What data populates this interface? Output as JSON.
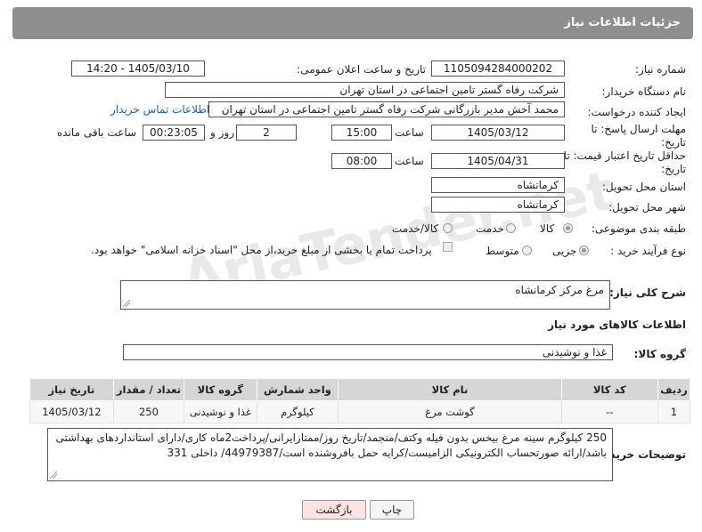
{
  "header": {
    "title": "جزئیات اطلاعات نیاز"
  },
  "form": {
    "need_number_label": "شماره نیاز:",
    "need_number": "1105094284000202",
    "announce_label": "تاریخ و ساعت اعلان عمومی:",
    "announce_value": "1405/03/10 - 14:20",
    "buyer_label": "نام دستگاه خریدار:",
    "buyer_value": "شرکت رفاه گستر تامین اجتماعی در استان تهران",
    "creator_label": "ایجاد کننده درخواست:",
    "creator_value": "محمد آخش مدیر بازرگانی شرکت رفاه گستر تامین اجتماعی در استان تهران",
    "contact_link": "اطلاعات تماس خریدار",
    "deadline_label": "مهلت ارسال پاسخ: تا تاریخ:",
    "deadline_date": "1405/03/12",
    "time_label": "ساعت",
    "deadline_time": "15:00",
    "days_value": "2",
    "days_label": "روز و",
    "remaining_value": "00:23:05",
    "remaining_label": "ساعت باقی مانده",
    "validity_label": "حداقل تاریخ اعتبار قیمت: تا تاریخ:",
    "validity_date": "1405/04/31",
    "validity_time": "08:00",
    "province_label": "استان محل تحویل:",
    "province_value": "کرمانشاه",
    "city_label": "شهر محل تحویل:",
    "city_value": "کرمانشاه",
    "category_label": "طبقه بندی موضوعی:",
    "category_options": [
      "کالا",
      "خدمت",
      "کالا/خدمت"
    ],
    "process_label": "نوع فرآیند خرید :",
    "process_options": [
      "جزیی",
      "متوسط"
    ],
    "payment_note": "پرداخت تمام یا بخشی از مبلغ خرید،از محل \"اسناد خزانه اسلامی\" خواهد بود."
  },
  "description": {
    "label": "شرح کلی نیاز:",
    "value": "مرغ مرکز کرمانشاه"
  },
  "goods": {
    "section_title": "اطلاعات کالاهای مورد نیاز",
    "group_label": "گروه کالا:",
    "group_value": "غذا و نوشیدنی",
    "columns": [
      "ردیف",
      "کد کالا",
      "نام کالا",
      "واحد شمارش",
      "گروه کالا",
      "تعداد / مقدار",
      "تاریخ نیاز"
    ],
    "rows": [
      {
        "row": "1",
        "code": "--",
        "name": "گوشت مرغ",
        "unit": "کیلوگرم",
        "group": "غذا و نوشیدنی",
        "qty": "250",
        "date": "1405/03/12"
      }
    ]
  },
  "buyer_notes": {
    "label": "توضیحات خریدار:",
    "value": "250 کیلوگرم سینه مرغ بیخس بدون فیله وکتف/منجمد/تاریخ روز/ممتازایرانی/پرداخت2ماه کاری/دارای استانداردهای بهداشتی باشد/ارائه صورتحساب الکترونیکی الزامیست/کرایه حمل بافروشنده است/44979387/ داخلی 331"
  },
  "buttons": {
    "print": "چاپ",
    "back": "بازگشت"
  },
  "watermark": "AriaTender.net",
  "colors": {
    "header_bg": "#8e8e8e",
    "link": "#1a5fb4",
    "back_button_bg": "#fbe3e3",
    "table_header_bg": "#d6d6d6"
  }
}
